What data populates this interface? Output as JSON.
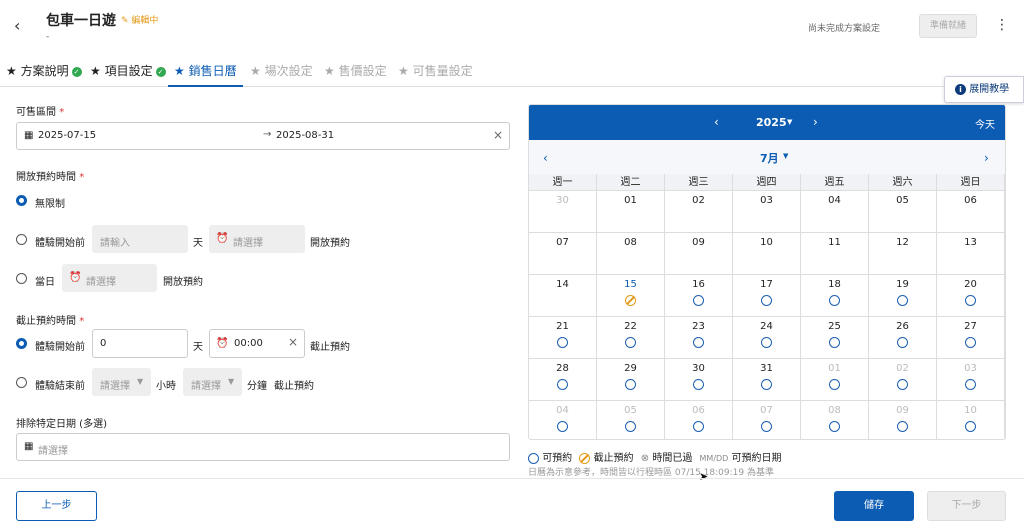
{
  "header": {
    "title": "包車一日遊",
    "editing": "編輯中",
    "sub": "-",
    "not_done": "尚未完成方案設定",
    "ready": "準備就緒"
  },
  "tabs": [
    {
      "label": "方案說明",
      "state": "done"
    },
    {
      "label": "項目設定",
      "state": "done"
    },
    {
      "label": "銷售日曆",
      "state": "active"
    },
    {
      "label": "場次設定",
      "state": "disabled"
    },
    {
      "label": "售價設定",
      "state": "disabled"
    },
    {
      "label": "可售量設定",
      "state": "disabled"
    }
  ],
  "tutorial": "展開教學",
  "sale_range": {
    "label": "可售區間",
    "start": "2025-07-15",
    "end": "2025-08-31"
  },
  "open_time": {
    "label": "開放預約時間",
    "opt1": "無限制",
    "opt2": "體驗開始前",
    "opt2_placeholder": "請輸入",
    "day": "天",
    "time_placeholder": "請選擇",
    "open_text": "開放預約",
    "opt3": "當日"
  },
  "close_time": {
    "label": "截止預約時間",
    "opt1": "體驗開始前",
    "days_value": "0",
    "day": "天",
    "time_value": "00:00",
    "close_text": "截止預約",
    "opt2": "體驗結束前",
    "select_placeholder": "請選擇",
    "hour": "小時",
    "minute": "分鐘"
  },
  "exclude": {
    "label": "排除特定日期 (多選)",
    "placeholder": "請選擇"
  },
  "calendar": {
    "year": "2025",
    "today": "今天",
    "month": "7月",
    "weekdays": [
      "週一",
      "週二",
      "週三",
      "週四",
      "週五",
      "週六",
      "週日"
    ],
    "days": [
      {
        "d": "30",
        "dim": true
      },
      {
        "d": "01"
      },
      {
        "d": "02"
      },
      {
        "d": "03"
      },
      {
        "d": "04"
      },
      {
        "d": "05"
      },
      {
        "d": "06"
      },
      {
        "d": "07"
      },
      {
        "d": "08"
      },
      {
        "d": "09"
      },
      {
        "d": "10"
      },
      {
        "d": "11"
      },
      {
        "d": "12"
      },
      {
        "d": "13"
      },
      {
        "d": "14"
      },
      {
        "d": "15",
        "today": true,
        "s": "stop"
      },
      {
        "d": "16",
        "s": "avail"
      },
      {
        "d": "17",
        "s": "avail"
      },
      {
        "d": "18",
        "s": "avail"
      },
      {
        "d": "19",
        "s": "avail"
      },
      {
        "d": "20",
        "s": "avail"
      },
      {
        "d": "21",
        "s": "avail"
      },
      {
        "d": "22",
        "s": "avail"
      },
      {
        "d": "23",
        "s": "avail"
      },
      {
        "d": "24",
        "s": "avail"
      },
      {
        "d": "25",
        "s": "avail"
      },
      {
        "d": "26",
        "s": "avail"
      },
      {
        "d": "27",
        "s": "avail"
      },
      {
        "d": "28",
        "s": "avail"
      },
      {
        "d": "29",
        "s": "avail"
      },
      {
        "d": "30",
        "s": "avail"
      },
      {
        "d": "31",
        "s": "avail"
      },
      {
        "d": "01",
        "dim": true,
        "s": "avail"
      },
      {
        "d": "02",
        "dim": true,
        "s": "avail"
      },
      {
        "d": "03",
        "dim": true,
        "s": "avail"
      },
      {
        "d": "04",
        "dim": true,
        "s": "avail"
      },
      {
        "d": "05",
        "dim": true,
        "s": "avail"
      },
      {
        "d": "06",
        "dim": true,
        "s": "avail"
      },
      {
        "d": "07",
        "dim": true,
        "s": "avail"
      },
      {
        "d": "08",
        "dim": true,
        "s": "avail"
      },
      {
        "d": "09",
        "dim": true,
        "s": "avail"
      },
      {
        "d": "10",
        "dim": true,
        "s": "avail"
      }
    ]
  },
  "legend": {
    "avail": "可預約",
    "stop": "截止預約",
    "past": "時間已過",
    "date_code": "MM/DD",
    "date_text": "可預約日期",
    "note": "日曆為示意參考，時間皆以行程時區 07/15 18:09:19 為基準"
  },
  "footer": {
    "prev": "上一步",
    "save": "儲存",
    "next": "下一步"
  }
}
